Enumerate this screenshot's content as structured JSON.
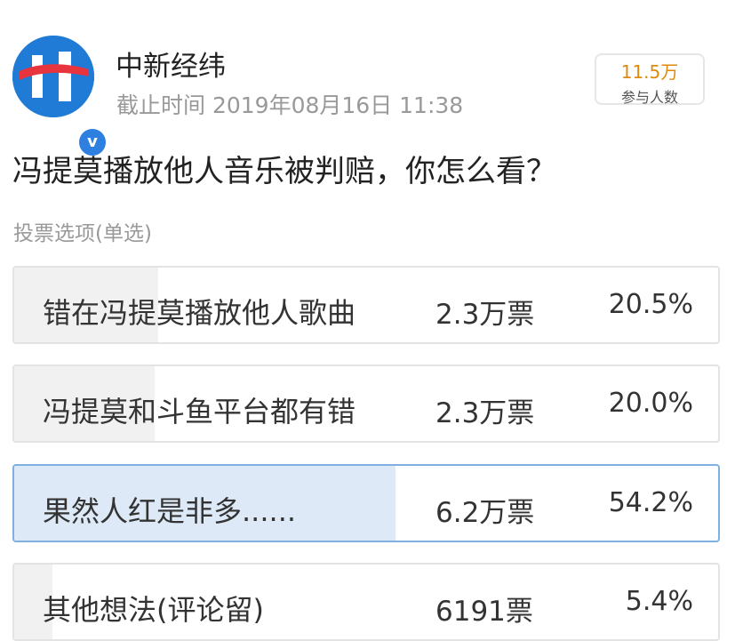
{
  "account": {
    "name": "中新经纬",
    "deadline": "截止时间 2019年08月16日 11:38",
    "logo": "chinanews-finance-logo",
    "verified_icon": "verified-badge-icon",
    "verified_glyph": "v"
  },
  "participants": {
    "count": "11.5万",
    "label": "参与人数"
  },
  "question": "冯提莫播放他人音乐被判赔，你怎么看？",
  "vote_type": "投票选项(单选)",
  "options": [
    {
      "label": "错在冯提莫播放他人歌曲",
      "votes": "2.3万票",
      "percent": "20.5%",
      "share": 20.5,
      "selected": false
    },
    {
      "label": "冯提莫和斗鱼平台都有错",
      "votes": "2.3万票",
      "percent": "20.0%",
      "share": 20.0,
      "selected": false
    },
    {
      "label": "果然人红是非多......",
      "votes": "6.2万票",
      "percent": "54.2%",
      "share": 54.2,
      "selected": true
    },
    {
      "label": "其他想法(评论留)",
      "votes": "6191票",
      "percent": "5.4%",
      "share": 5.4,
      "selected": false
    }
  ],
  "colors": {
    "accent": "#7eb1e2",
    "selected_fill": "#dde9f7",
    "unselected_fill": "#f1f1f1",
    "participants_count": "#e08a0d"
  }
}
